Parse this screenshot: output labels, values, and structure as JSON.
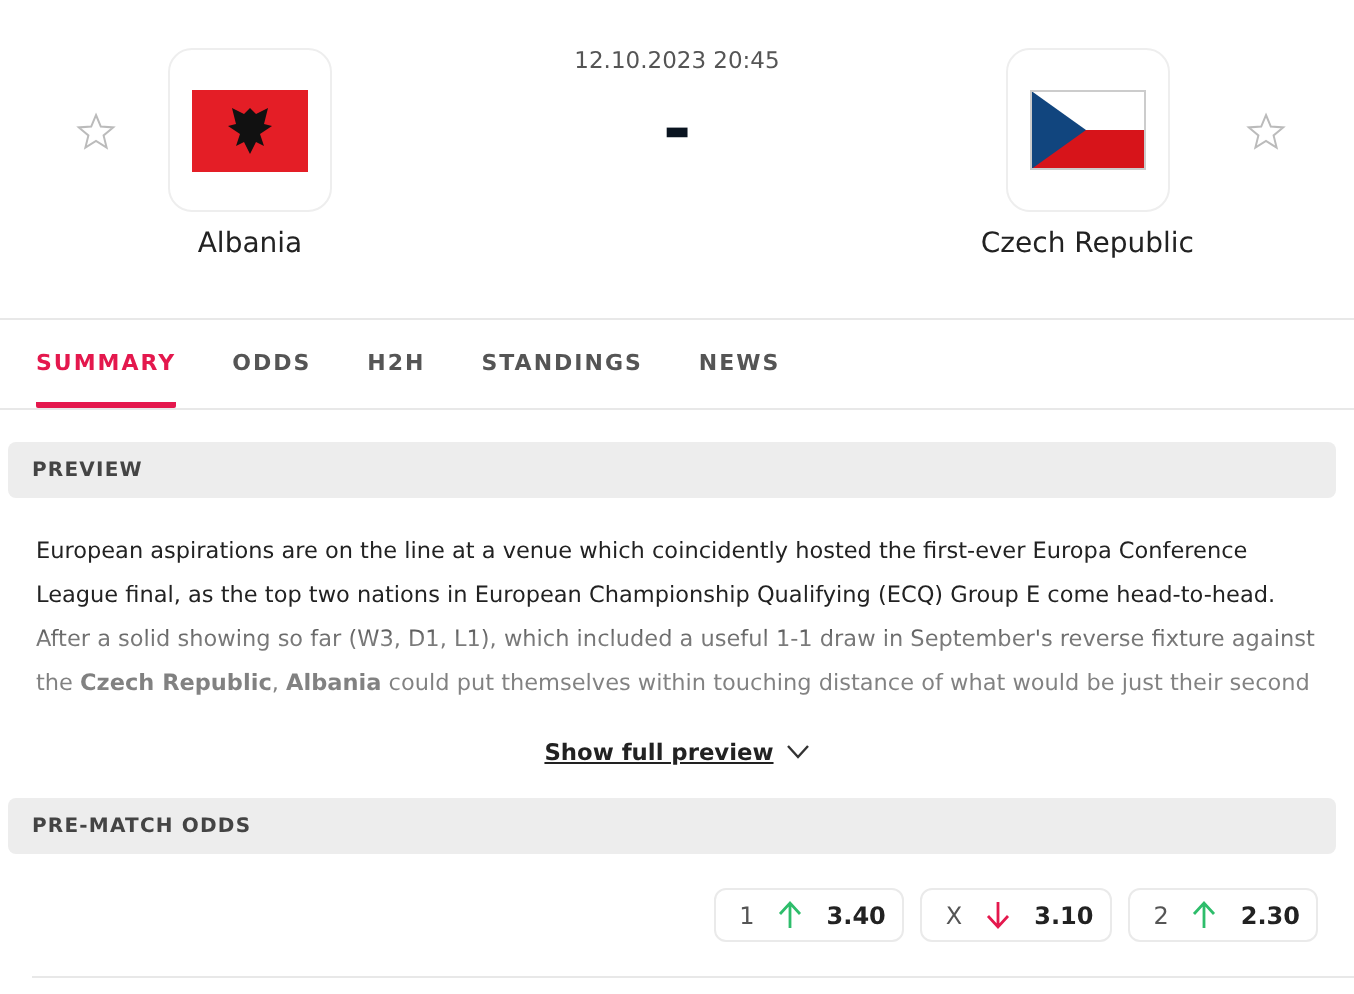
{
  "match": {
    "datetime": "12.10.2023 20:45",
    "score": "-",
    "home": {
      "name": "Albania",
      "flag": {
        "kind": "albania"
      },
      "favorite": false
    },
    "away": {
      "name": "Czech Republic",
      "flag": {
        "kind": "czech"
      },
      "favorite": false
    }
  },
  "tabs": [
    {
      "label": "SUMMARY",
      "selected": true
    },
    {
      "label": "ODDS",
      "selected": false
    },
    {
      "label": "H2H",
      "selected": false
    },
    {
      "label": "STANDINGS",
      "selected": false
    },
    {
      "label": "NEWS",
      "selected": false
    }
  ],
  "preview": {
    "title": "PREVIEW",
    "text": "European aspirations are on the line at a venue which coincidently hosted the first-ever Europa Conference League final, as the top two nations in European Championship Qualifying (ECQ) Group E come head-to-head. After a solid showing so far (W3, D1, L1), which included a useful 1-1 draw in September's reverse fixture against the **Czech Republic**, **Albania** could put themselves within touching distance of what would be just their second",
    "link": "Show full preview"
  },
  "odds": {
    "title": "PRE-MATCH ODDS",
    "items": [
      {
        "label": "1",
        "rising": true,
        "value": "3.40"
      },
      {
        "label": "X",
        "rising": false,
        "value": "3.10"
      },
      {
        "label": "2",
        "rising": true,
        "value": "2.30"
      }
    ]
  }
}
